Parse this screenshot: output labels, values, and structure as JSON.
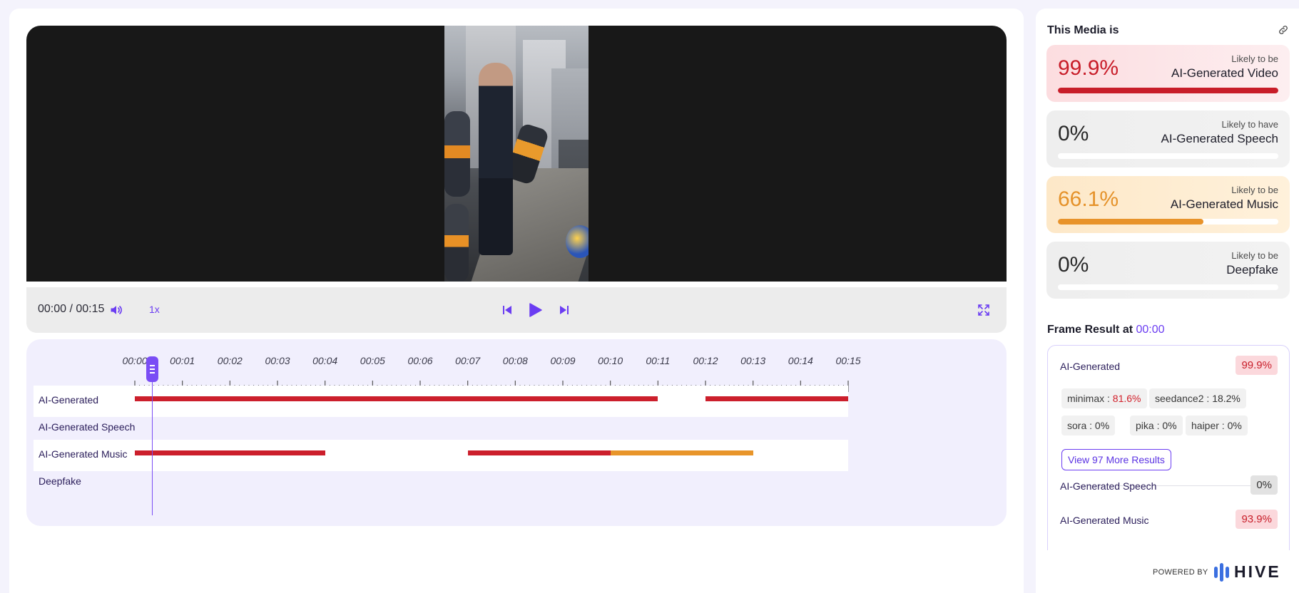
{
  "player": {
    "time": "00:00 / 00:15",
    "speed": "1x"
  },
  "timeline": {
    "ticks": [
      "00:00",
      "00:01",
      "00:02",
      "00:03",
      "00:04",
      "00:05",
      "00:06",
      "00:07",
      "00:08",
      "00:09",
      "00:10",
      "00:11",
      "00:12",
      "00:13",
      "00:14",
      "00:15"
    ],
    "duration_seconds": 15,
    "tracks": [
      {
        "label": "AI-Generated",
        "segments": [
          {
            "start": 0,
            "end": 11,
            "color": "#cc1f2c"
          },
          {
            "start": 12,
            "end": 15,
            "color": "#cc1f2c"
          }
        ]
      },
      {
        "label": "AI-Generated Speech",
        "segments": []
      },
      {
        "label": "AI-Generated Music",
        "segments": [
          {
            "start": 0,
            "end": 4,
            "color": "#cc1f2c"
          },
          {
            "start": 7,
            "end": 10,
            "color": "#cc1f2c"
          },
          {
            "start": 10,
            "end": 13,
            "color": "#e8952a"
          }
        ]
      },
      {
        "label": "Deepfake",
        "segments": []
      }
    ]
  },
  "sidebar": {
    "title": "This Media is",
    "cards": [
      {
        "pct": "99.9%",
        "fraction": 0.999,
        "top": "Likely to be",
        "main": "AI-Generated Video",
        "bg": "linear-gradient(90deg,#fcdde0,#fdeef0)",
        "pct_color": "#c81d29",
        "bar_color": "#c81d29"
      },
      {
        "pct": "0%",
        "fraction": 0,
        "top": "Likely to have",
        "main": "AI-Generated Speech",
        "bg": "linear-gradient(90deg,#eeeeee,#f2f2f2)",
        "pct_color": "#2a2a2a",
        "bar_color": "#999999"
      },
      {
        "pct": "66.1%",
        "fraction": 0.661,
        "top": "Likely to be",
        "main": "AI-Generated Music",
        "bg": "linear-gradient(90deg,#fde8c8,#fff1db)",
        "pct_color": "#e5922a",
        "bar_color": "#e8932a"
      },
      {
        "pct": "0%",
        "fraction": 0,
        "top": "Likely to be",
        "main": "Deepfake",
        "bg": "linear-gradient(90deg,#eeeeee,#f2f2f2)",
        "pct_color": "#2a2a2a",
        "bar_color": "#999999"
      }
    ],
    "frame": {
      "title": "Frame Result at",
      "timestamp": "00:00",
      "rows": [
        {
          "label": "AI-Generated",
          "value": "99.9%"
        },
        {
          "label": "AI-Generated Speech",
          "value": "0%"
        },
        {
          "label": "AI-Generated Music",
          "value": "93.9%"
        }
      ],
      "chips": [
        {
          "name": "minimax",
          "value": "81.6%"
        },
        {
          "name": "seedance2",
          "value": "18.2%"
        },
        {
          "name": "sora",
          "value": "0%"
        },
        {
          "name": "pika",
          "value": "0%"
        },
        {
          "name": "haiper",
          "value": "0%"
        }
      ],
      "more_button": "View 97 More Results"
    }
  },
  "footer": {
    "powered_by": "POWERED BY",
    "brand": "HIVE"
  },
  "colors": {
    "accent": "#6b3df2",
    "red": "#cc1f2c",
    "orange": "#e8952a"
  }
}
